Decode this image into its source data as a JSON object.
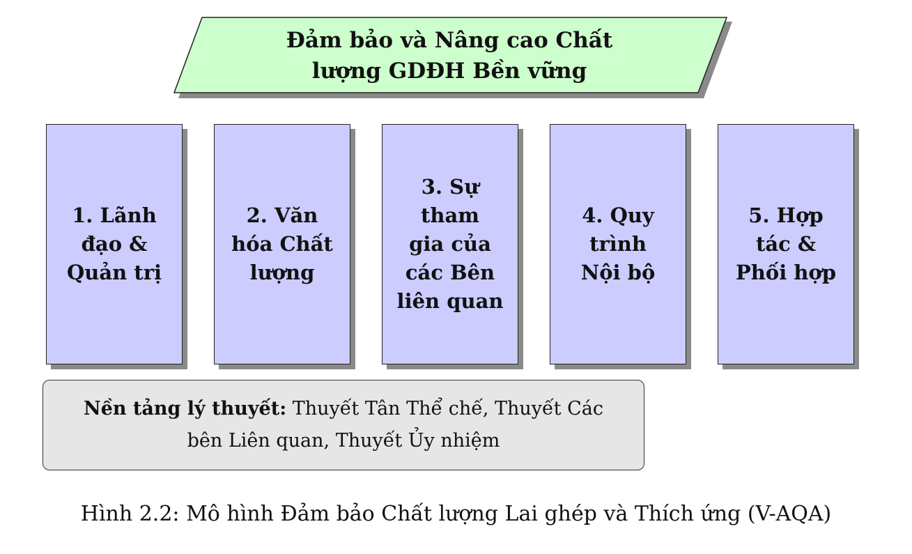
{
  "colors": {
    "top_fill": "#ccffcc",
    "pillar_fill": "#ccccff",
    "theory_fill": "#e6e6e6",
    "shadow": "#8a8a8a",
    "border": "#222222"
  },
  "top": {
    "title": "Đảm bảo và Nâng cao Chất\nlượng GDĐH Bền vững"
  },
  "pillars": [
    {
      "label": "1. Lãnh\nđạo &\nQuản trị"
    },
    {
      "label": "2. Văn\nhóa Chất\nlượng"
    },
    {
      "label": "3. Sự\ntham\ngia của\ncác Bên\nliên quan"
    },
    {
      "label": "4. Quy\ntrình\nNội bộ"
    },
    {
      "label": "5. Hợp\ntác &\nPhối hợp"
    }
  ],
  "theory": {
    "heading": "Nền tảng lý thuyết:",
    "text": " Thuyết Tân Thể chế, Thuyết Các bên Liên quan, Thuyết Ủy nhiệm"
  },
  "caption": "Hình 2.2: Mô hình Đảm bảo Chất lượng Lai ghép và Thích ứng (V-AQA)"
}
